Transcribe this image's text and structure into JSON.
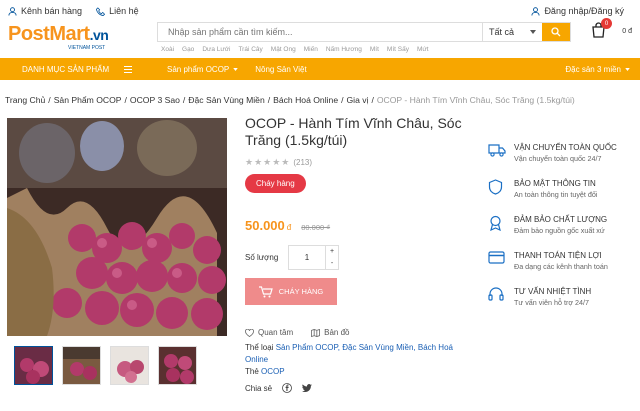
{
  "topbar": {
    "channel": "Kênh bán hàng",
    "contact": "Liên hệ",
    "login": "Đăng nhập/Đăng ký"
  },
  "logo": {
    "main": "PostMart",
    "domain": ".vn",
    "sub": "VIETNAM POST"
  },
  "search": {
    "placeholder": "Nhập sản phẩm cần tìm kiếm...",
    "category": "Tất cả",
    "keywords": [
      "Xoài",
      "Gạo",
      "Dưa Lưới",
      "Trái Cây",
      "Mật Ong",
      "Miến",
      "Nấm Hương",
      "Mít",
      "Mít Sấy",
      "Mứt"
    ]
  },
  "cart": {
    "count": "0",
    "total": "0 đ"
  },
  "nav": {
    "menu": "DANH MỤC SẢN PHẨM",
    "link1": "Sản phẩm OCOP",
    "link2": "Nông Sản Việt",
    "right": "Đặc sản 3 miền"
  },
  "breadcrumb": [
    "Trang Chủ",
    "Sản Phẩm OCOP",
    "OCOP 3 Sao",
    "Đặc Sản Vùng Miền",
    "Bách Hoá Online",
    "Gia vị",
    "OCOP - Hành Tím Vĩnh Châu, Sóc Trăng (1.5kg/túi)"
  ],
  "product": {
    "title": "OCOP - Hành Tím Vĩnh Châu, Sóc Trăng (1.5kg/túi)",
    "stars": 0,
    "reviews": "(213)",
    "badge": "Cháy hàng",
    "price": "50.000",
    "currency": "đ",
    "old_price": "80.000 ₫",
    "qty_label": "Số lượng",
    "qty": "1",
    "buy_label": "CHÁY HÀNG",
    "wishlist": "Quan tâm",
    "map": "Bản đồ",
    "category_label": "Thể loại",
    "categories": "Sản Phẩm OCOP, Đặc Sản Vùng Miền, Bách Hoá Online",
    "tag_label": "Thẻ",
    "tag": "OCOP",
    "share_label": "Chia sẻ"
  },
  "services": [
    {
      "title": "VẬN CHUYỂN TOÀN QUỐC",
      "desc": "Vận chuyển toàn quốc 24/7",
      "icon": "truck-icon"
    },
    {
      "title": "BẢO MẬT THÔNG TIN",
      "desc": "An toàn thông tin tuyệt đối",
      "icon": "shield-icon"
    },
    {
      "title": "ĐẢM BẢO CHẤT LƯỢNG",
      "desc": "Đảm bảo nguồn gốc xuất xứ",
      "icon": "badge-icon"
    },
    {
      "title": "THANH TOÁN TIỆN LỢI",
      "desc": "Đa dạng các kênh thanh toán",
      "icon": "card-icon"
    },
    {
      "title": "TƯ VẤN NHIỆT TÌNH",
      "desc": "Tư vấn viên hỗ trợ 24/7",
      "icon": "headset-icon"
    }
  ],
  "colors": {
    "accent": "#f7a600",
    "brand_blue": "#00539b",
    "hot": "#e53945",
    "price": "#f7941d"
  }
}
